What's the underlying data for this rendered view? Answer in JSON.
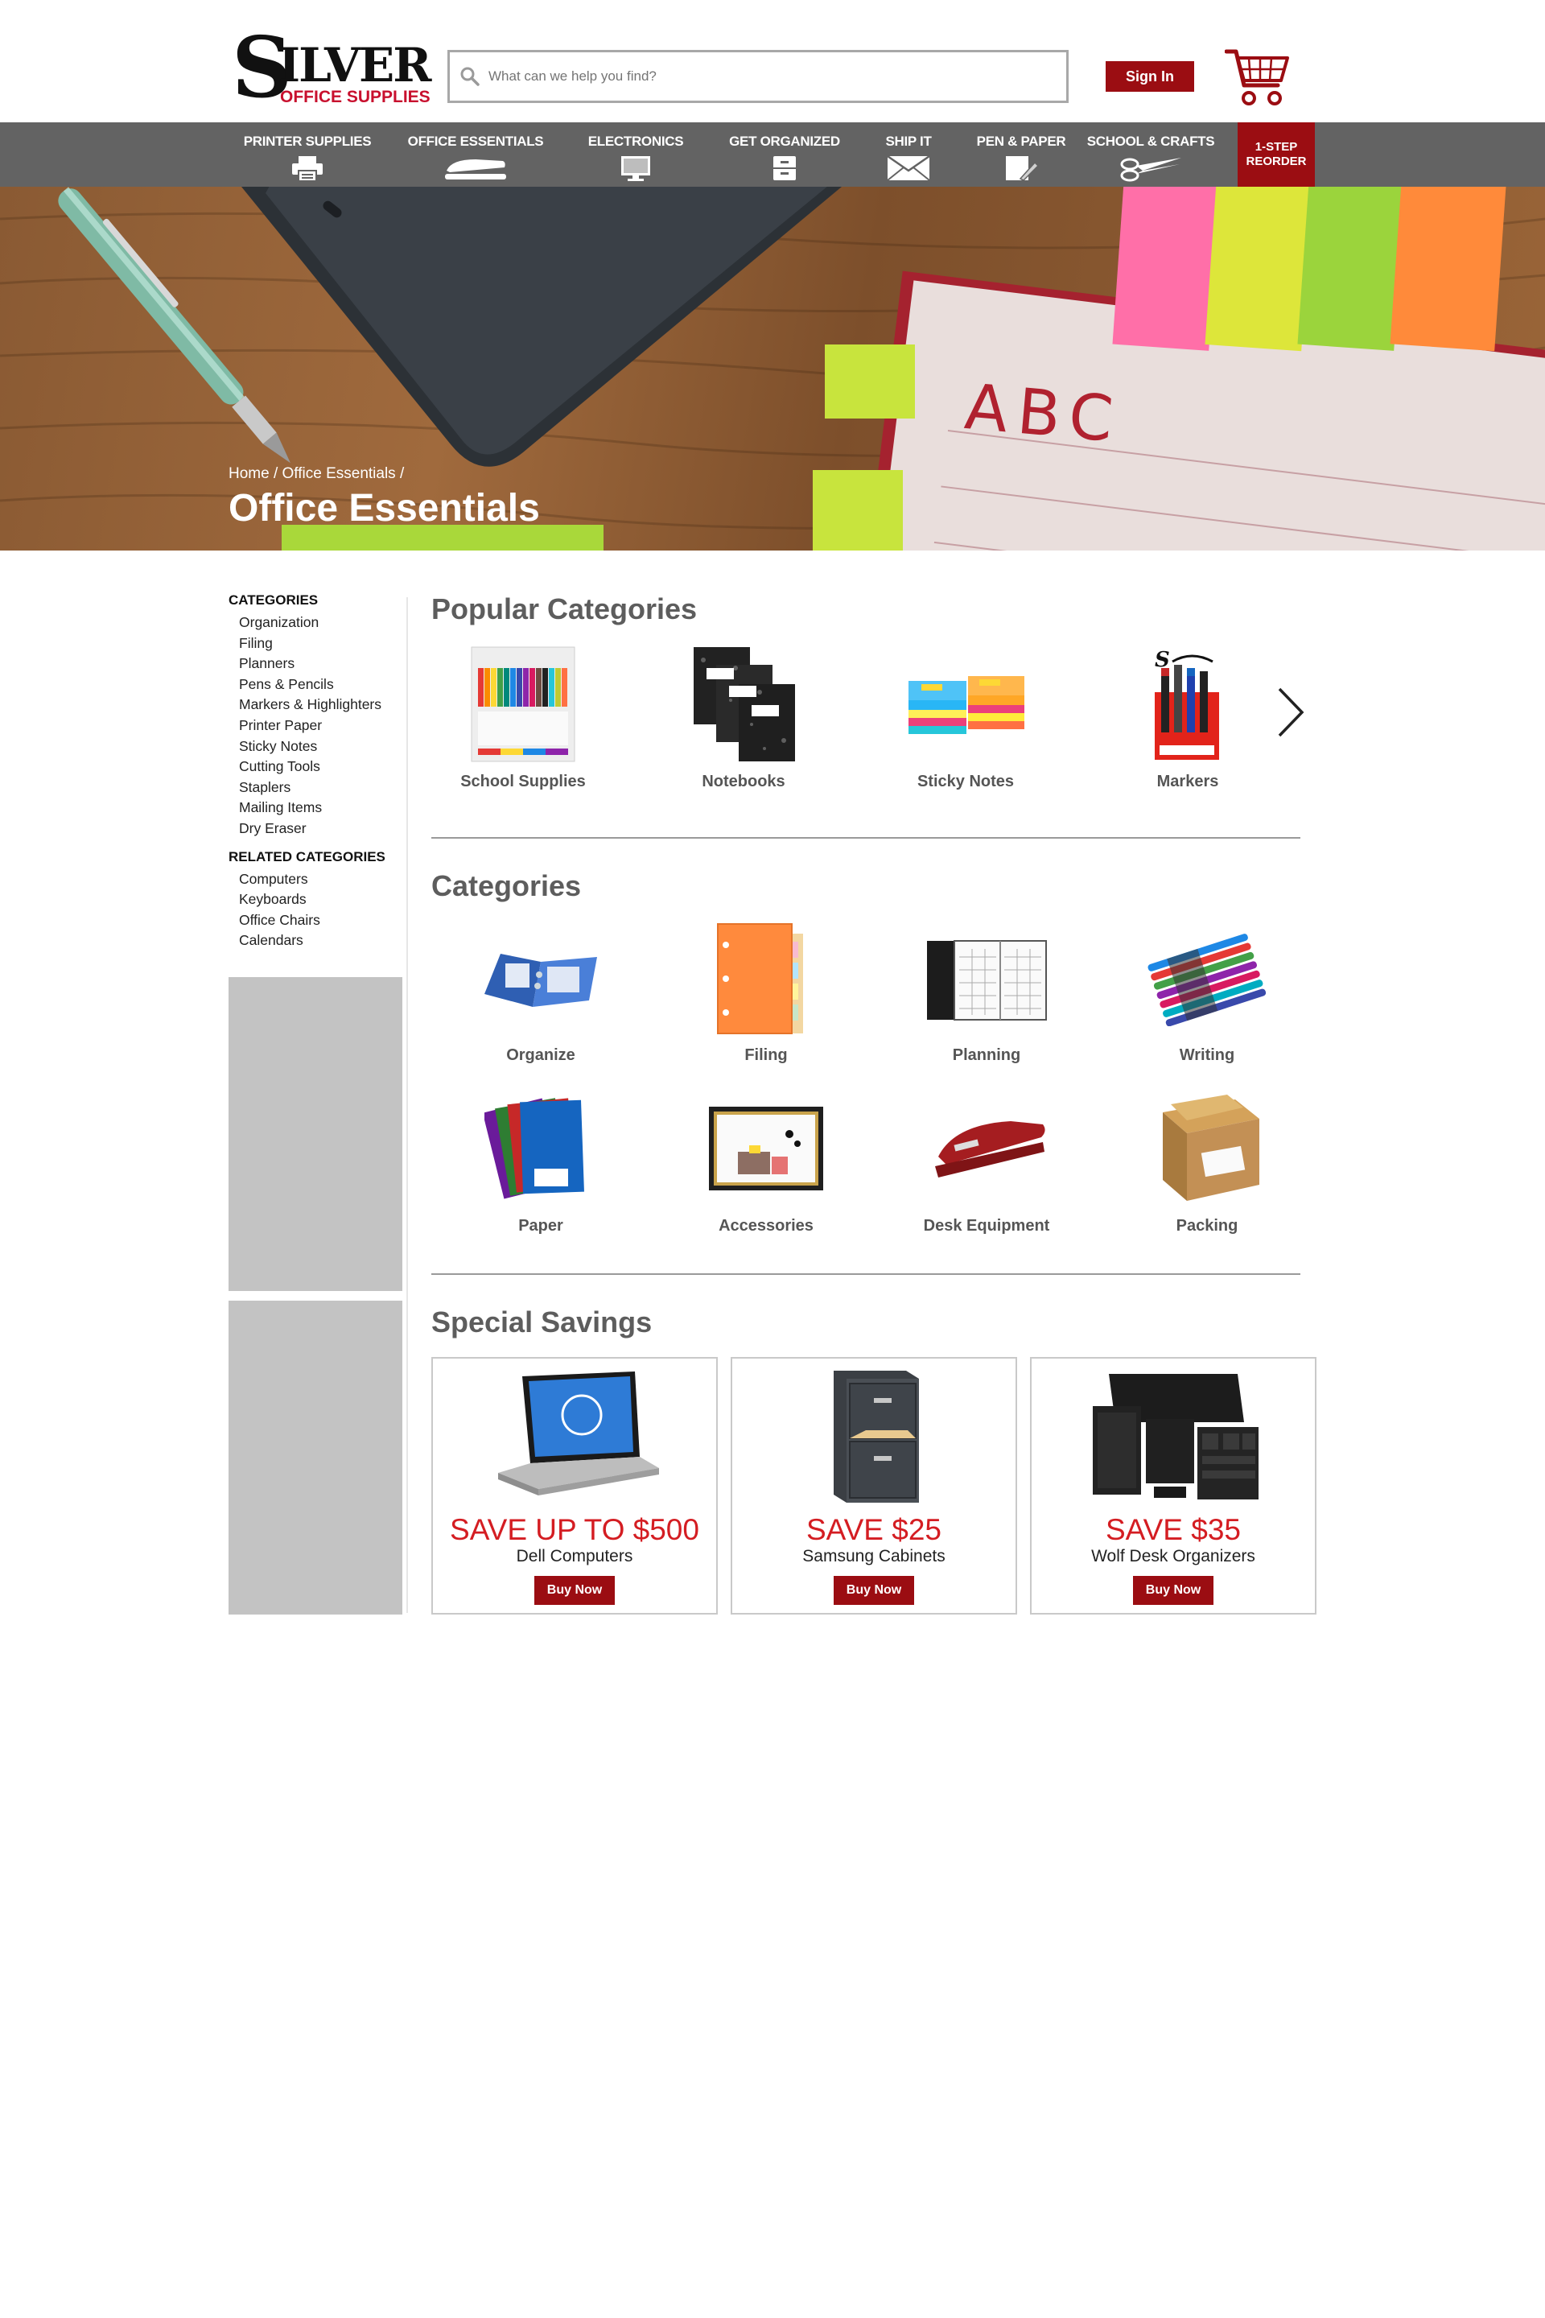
{
  "brand": {
    "logo_big": "S",
    "logo_rest": "ILVER",
    "logo_sub": "OFFICE SUPPLIES"
  },
  "header": {
    "search_placeholder": "What can we help you find?",
    "signin_label": "Sign In",
    "cart_icon": "shopping-cart-icon"
  },
  "nav": {
    "items": [
      {
        "label": "PRINTER SUPPLIES",
        "icon": "printer-icon"
      },
      {
        "label": "OFFICE ESSENTIALS",
        "icon": "stapler-icon"
      },
      {
        "label": "ELECTRONICS",
        "icon": "monitor-icon"
      },
      {
        "label": "GET ORGANIZED",
        "icon": "file-cabinet-icon"
      },
      {
        "label": "SHIP IT",
        "icon": "envelope-icon"
      },
      {
        "label": "PEN & PAPER",
        "icon": "pen-paper-icon"
      },
      {
        "label": "SCHOOL & CRAFTS",
        "icon": "scissors-icon"
      }
    ],
    "reorder_line1": "1-STEP",
    "reorder_line2": "REORDER"
  },
  "hero": {
    "crumb_home": "Home",
    "crumb_current": "Office Essentials",
    "title": "Office Essentials",
    "notebook_text": "ABC"
  },
  "sidebar": {
    "categories_heading": "CATEGORIES",
    "categories": [
      "Organization",
      "Filing",
      "Planners",
      "Pens & Pencils",
      "Markers & Highlighters",
      "Printer Paper",
      "Sticky Notes",
      "Cutting Tools",
      "Staplers",
      "Mailing Items",
      "Dry Eraser"
    ],
    "related_heading": "RELATED CATEGORIES",
    "related": [
      "Computers",
      "Keyboards",
      "Office Chairs",
      "Calendars"
    ]
  },
  "popular": {
    "title": "Popular Categories",
    "items": [
      "School Supplies",
      "Notebooks",
      "Sticky Notes",
      "Markers"
    ]
  },
  "categories": {
    "title": "Categories",
    "items": [
      "Organize",
      "Filing",
      "Planning",
      "Writing",
      "Paper",
      "Accessories",
      "Desk Equipment",
      "Packing"
    ]
  },
  "savings": {
    "title": "Special Savings",
    "deals": [
      {
        "headline": "SAVE UP TO $500",
        "product": "Dell Computers",
        "button": "Buy Now"
      },
      {
        "headline": "SAVE $25",
        "product": "Samsung Cabinets",
        "button": "Buy Now"
      },
      {
        "headline": "SAVE $35",
        "product": "Wolf Desk Organizers",
        "button": "Buy Now"
      }
    ]
  },
  "colors": {
    "brand_red": "#9b0d12",
    "nav_gray": "#636363",
    "deal_red": "#d41d22",
    "ad_gray": "#c3c3c3"
  }
}
